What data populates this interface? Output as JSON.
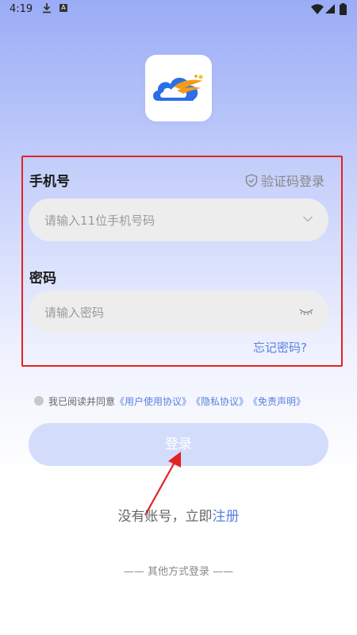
{
  "status_bar": {
    "time": "4:19",
    "notif_letter": "A",
    "icons": [
      "download-icon",
      "a-badge-icon",
      "wifi-icon",
      "signal-icon",
      "battery-icon"
    ]
  },
  "form": {
    "phone_label": "手机号",
    "sms_login": "验证码登录",
    "phone_placeholder": "请输入11位手机号码",
    "password_label": "密码",
    "password_placeholder": "请输入密码",
    "forgot": "忘记密码?"
  },
  "agreement": {
    "prefix": "我已阅读并同意",
    "user_agreement": "《用户使用协议》",
    "privacy": "《隐私协议》",
    "disclaimer": "《免责声明》"
  },
  "login_button": "登录",
  "register": {
    "prefix": "没有账号，立即",
    "link": "注册"
  },
  "other_login": "—— 其他方式登录 ——",
  "colors": {
    "accent": "#5b7fe0",
    "annotation_red": "#e32222",
    "button_bg": "#d3ddfb"
  }
}
